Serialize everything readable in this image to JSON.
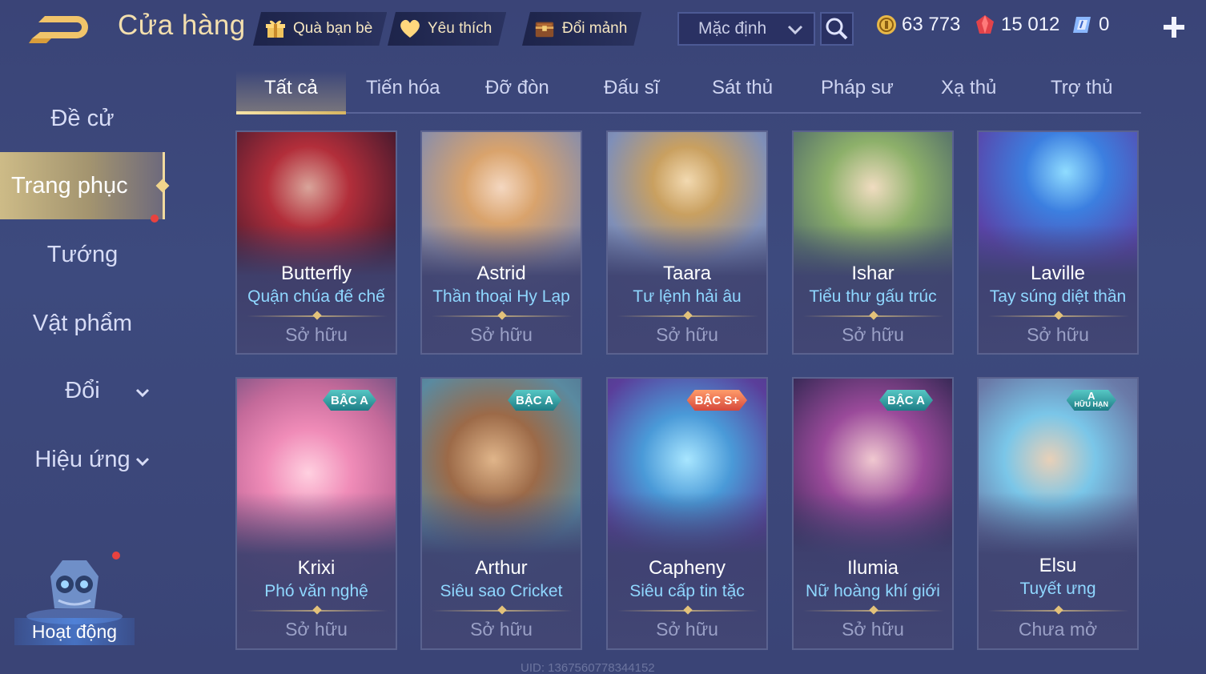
{
  "header": {
    "title": "Cửa hàng",
    "buttons": [
      {
        "label": "Quà bạn bè",
        "icon": "gift-icon"
      },
      {
        "label": "Yêu thích",
        "icon": "heart-icon"
      },
      {
        "label": "Đổi mảnh",
        "icon": "chest-icon"
      }
    ],
    "sort": {
      "value": "Mặc định"
    },
    "currencies": [
      {
        "icon": "gold-coin-icon",
        "value": "63 773"
      },
      {
        "icon": "red-gem-icon",
        "value": "15 012"
      },
      {
        "icon": "voucher-icon",
        "value": "0"
      }
    ]
  },
  "sidebar": {
    "items": [
      {
        "label": "Đề cử"
      },
      {
        "label": "Trang phục"
      },
      {
        "label": "Tướng"
      },
      {
        "label": "Vật phẩm"
      },
      {
        "label": "Đổi"
      },
      {
        "label": "Hiệu ứng"
      }
    ],
    "event_label": "Hoạt động"
  },
  "tabs": [
    "Tất cả",
    "Tiến hóa",
    "Đỡ đòn",
    "Đấu sĩ",
    "Sát thủ",
    "Pháp sư",
    "Xạ thủ",
    "Trợ thủ"
  ],
  "cards": [
    {
      "hero": "Butterfly",
      "skin": "Quận chúa đế chế",
      "status": "Sở hữu",
      "badge": ""
    },
    {
      "hero": "Astrid",
      "skin": "Thần thoại Hy Lạp",
      "status": "Sở hữu",
      "badge": ""
    },
    {
      "hero": "Taara",
      "skin": "Tư lệnh hải âu",
      "status": "Sở hữu",
      "badge": ""
    },
    {
      "hero": "Ishar",
      "skin": "Tiểu thư gấu trúc",
      "status": "Sở hữu",
      "badge": ""
    },
    {
      "hero": "Laville",
      "skin": "Tay súng diệt thần",
      "status": "Sở hữu",
      "badge": ""
    },
    {
      "hero": "Krixi",
      "skin": "Phó văn nghệ",
      "status": "Sở hữu",
      "badge": "BẬC A"
    },
    {
      "hero": "Arthur",
      "skin": "Siêu sao Cricket",
      "status": "Sở hữu",
      "badge": "BẬC A"
    },
    {
      "hero": "Capheny",
      "skin": "Siêu cấp tin tặc",
      "status": "Sở hữu",
      "badge": "BẬC S+"
    },
    {
      "hero": "Ilumia",
      "skin": "Nữ hoàng khí giới",
      "status": "Sở hữu",
      "badge": "BẬC A"
    },
    {
      "hero": "Elsu",
      "skin": "Tuyết ưng",
      "status": "Chưa mở",
      "badge": "A",
      "badge_sub": "HỮU HẠN"
    }
  ],
  "footer": {
    "uid": "UID: 1367560778344152"
  },
  "colors": {
    "accent_gold": "#f3dfae",
    "skin_name": "#8fd7ff",
    "status_gray": "#9aa0c6",
    "badge_teal": "#3aa8aa",
    "badge_splus": "#e5603f"
  }
}
